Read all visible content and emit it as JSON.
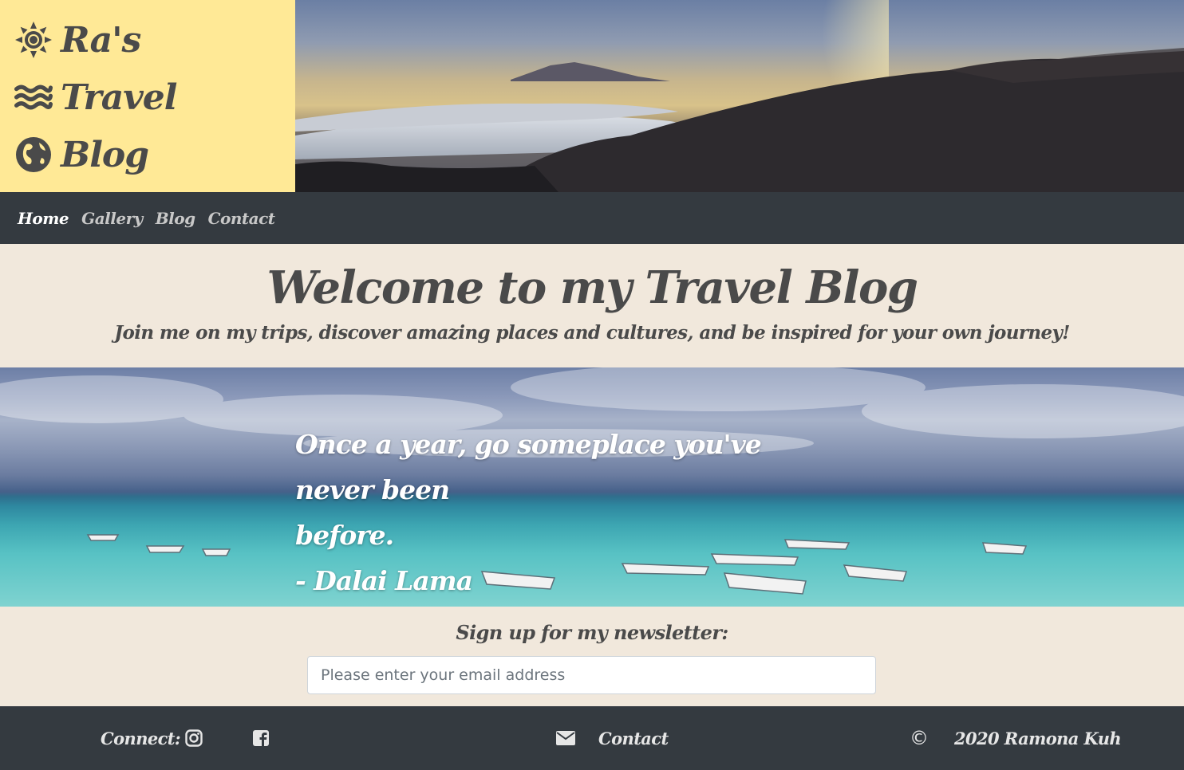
{
  "brand": {
    "lines": [
      {
        "icon": "sun-icon",
        "text": "Ra's"
      },
      {
        "icon": "waves-icon",
        "text": "Travel"
      },
      {
        "icon": "globe-icon",
        "text": "Blog"
      }
    ],
    "background": "#ffe996"
  },
  "nav": {
    "items": [
      {
        "label": "Home",
        "active": true
      },
      {
        "label": "Gallery",
        "active": false
      },
      {
        "label": "Blog",
        "active": false
      },
      {
        "label": "Contact",
        "active": false
      }
    ]
  },
  "welcome": {
    "title": "Welcome to my Travel Blog",
    "subtitle": "Join me on my trips, discover amazing places and cultures, and be inspired for your own journey!"
  },
  "quote": {
    "line1": "Once a year, go someplace you've never been",
    "line2": "before.",
    "author": "- Dalai Lama"
  },
  "newsletter": {
    "label": "Sign up for my newsletter:",
    "placeholder": "Please enter your email address"
  },
  "footer": {
    "connect_label": "Connect:",
    "instagram_icon": "instagram-icon",
    "facebook_icon": "facebook-icon",
    "envelope_icon": "envelope-icon",
    "contact_label": "Contact",
    "copyright_symbol": "©",
    "copyright_text": "2020 Ramona Kuh"
  },
  "colors": {
    "nav_bg": "#343a40",
    "page_bg": "#f1e8dc",
    "text": "#4a4a4a"
  }
}
